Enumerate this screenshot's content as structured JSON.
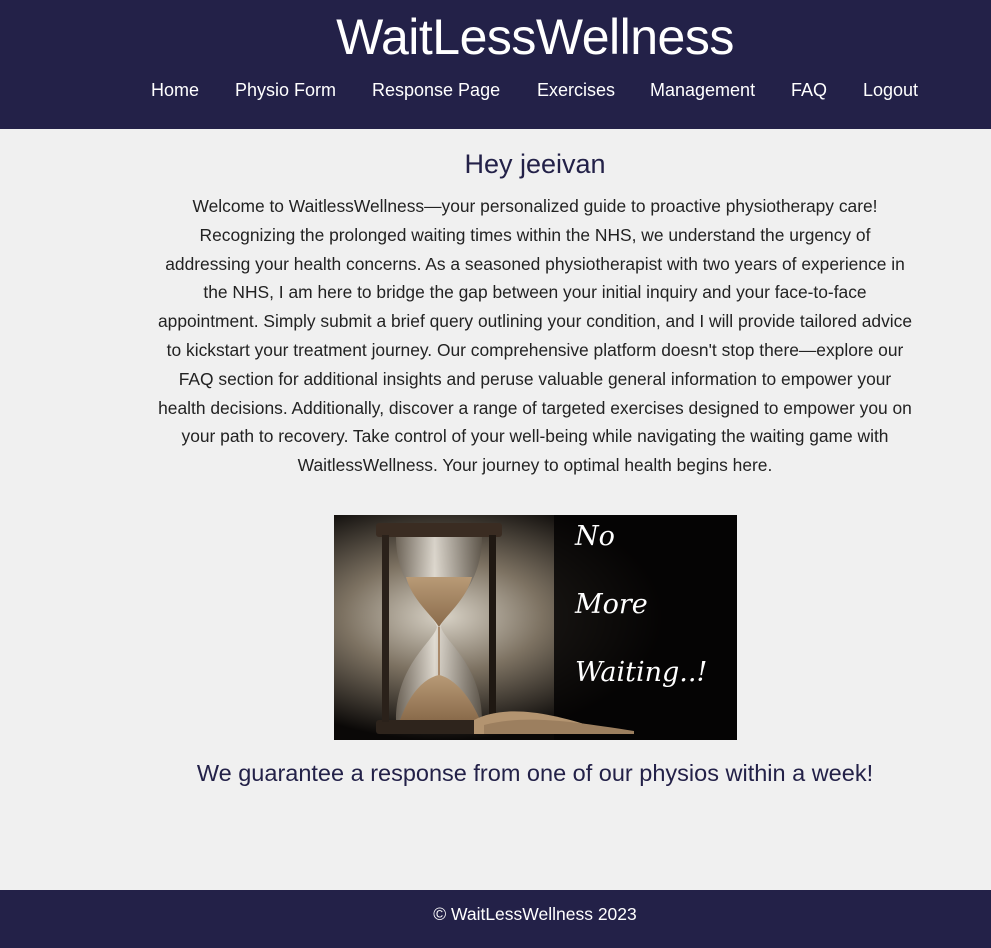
{
  "header": {
    "site_title": "WaitLessWellness",
    "background_color": "#232148",
    "nav": [
      {
        "label": "Home"
      },
      {
        "label": "Physio Form"
      },
      {
        "label": "Response Page"
      },
      {
        "label": "Exercises"
      },
      {
        "label": "Management"
      },
      {
        "label": "FAQ"
      },
      {
        "label": "Logout"
      }
    ]
  },
  "main": {
    "greeting": "Hey jeeivan",
    "intro": "Welcome to WaitlessWellness—your personalized guide to proactive physiotherapy care! Recognizing the prolonged waiting times within the NHS, we understand the urgency of addressing your health concerns. As a seasoned physiotherapist with two years of experience in the NHS, I am here to bridge the gap between your initial inquiry and your face-to-face appointment. Simply submit a brief query outlining your condition, and I will provide tailored advice to kickstart your treatment journey. Our comprehensive platform doesn't stop there—explore our FAQ section for additional insights and peruse valuable general information to empower your health decisions. Additionally, discover a range of targeted exercises designed to empower you on your path to recovery. Take control of your well-being while navigating the waiting game with WaitlessWellness. Your journey to optimal health begins here.",
    "banner": {
      "icon": "hourglass-icon",
      "lines": [
        "No",
        "More",
        "Waiting..!"
      ]
    },
    "guarantee": "We guarantee a response from one of our physios within a week!"
  },
  "footer": {
    "copyright": "© WaitLessWellness 2023"
  },
  "colors": {
    "brand_navy": "#232148",
    "page_background": "#f0f0f0",
    "body_text": "#222222"
  }
}
